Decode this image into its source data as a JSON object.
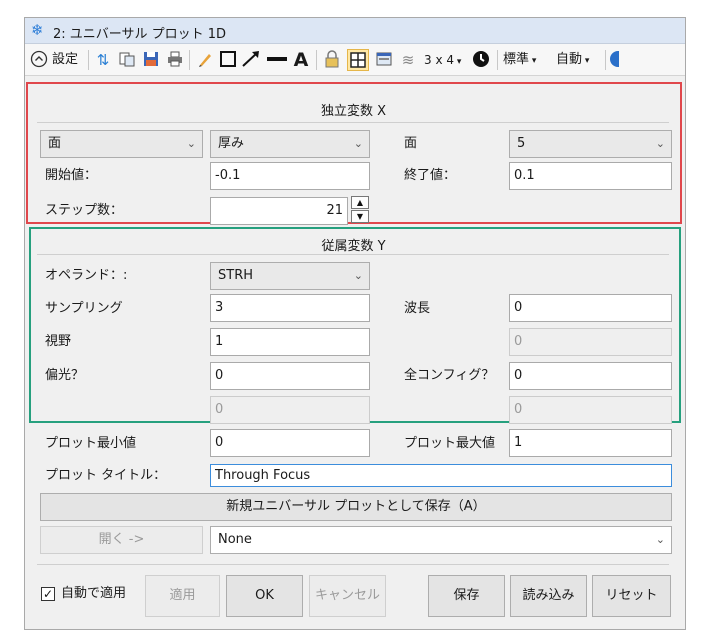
{
  "window": {
    "title": "2: ユニバーサル プロット 1D"
  },
  "toolbar": {
    "settings_label": "設定",
    "layout_label": "3 x 4",
    "standard_label": "標準",
    "auto_label": "自動"
  },
  "independent": {
    "title": "独立変数 X",
    "type1": "面",
    "param": "厚み",
    "type2_label": "面",
    "surface": "5",
    "start_label": "開始値：",
    "start_value": "-0.1",
    "end_label": "終了値：",
    "end_value": "0.1",
    "steps_label": "ステップ数：",
    "steps_value": "21"
  },
  "dependent": {
    "title": "従属変数 Y",
    "operand_label": "オペランド：:",
    "operand_value": "STRH",
    "sampling_label": "サンプリング",
    "sampling_value": "3",
    "wave_label": "波長",
    "wave_value": "0",
    "field_label": "視野",
    "field_value": "1",
    "disabled1_value": "0",
    "polar_label": "偏光？",
    "polar_value": "0",
    "config_label": "全コンフィグ？",
    "config_value": "0",
    "disabled2_value": "0",
    "disabled3_value": "0"
  },
  "plot": {
    "min_label": "プロット最小値",
    "min_value": "0",
    "max_label": "プロット最大値",
    "max_value": "1",
    "title_label": "プロット タイトル：",
    "title_value": "Through Focus"
  },
  "save_new_label": "新規ユニバーサル プロットとして保存（A）",
  "open_label": "開く ->",
  "open_select": "None",
  "bottom": {
    "auto_apply_label": "自動で適用",
    "apply_label": "適用",
    "ok_label": "OK",
    "cancel_label": "キャンセル",
    "save_label": "保存",
    "load_label": "読み込み",
    "reset_label": "リセット"
  }
}
